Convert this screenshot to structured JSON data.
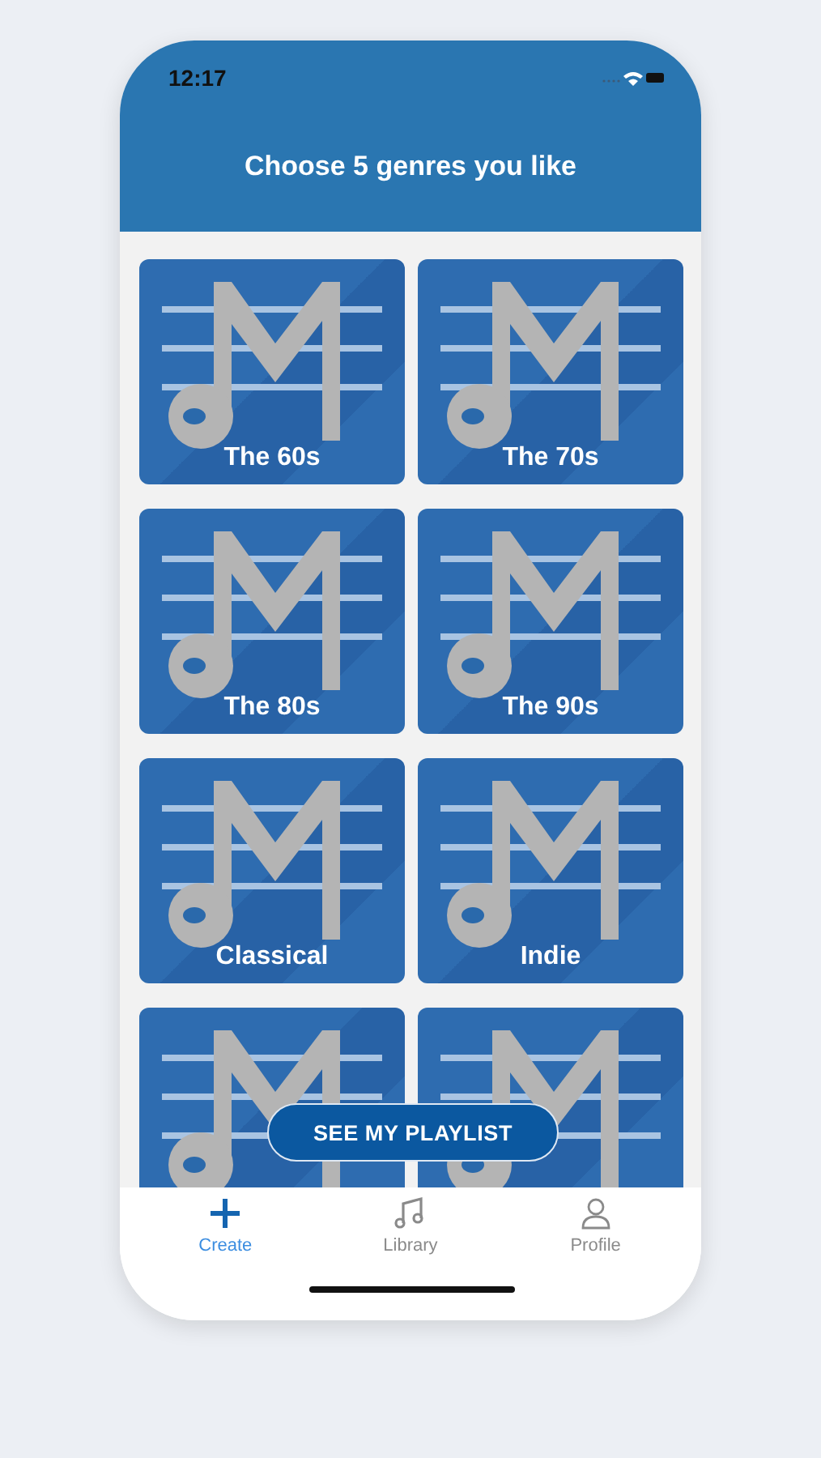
{
  "status_bar": {
    "time": "12:17"
  },
  "header": {
    "title": "Choose 5 genres you like"
  },
  "genres": [
    {
      "kind": "labeled",
      "label": "The 60s"
    },
    {
      "kind": "labeled",
      "label": "The 70s"
    },
    {
      "kind": "labeled",
      "label": "The 80s"
    },
    {
      "kind": "labeled",
      "label": "The 90s"
    },
    {
      "kind": "labeled",
      "label": "Classical"
    },
    {
      "kind": "labeled",
      "label": "Indie"
    },
    {
      "kind": "partial"
    },
    {
      "kind": "partial"
    }
  ],
  "action_button": {
    "label": "SEE MY PLAYLIST"
  },
  "tabs": [
    {
      "label": "Create",
      "selected": true
    },
    {
      "label": "Library",
      "selected": false
    },
    {
      "label": "Profile",
      "selected": false
    }
  ]
}
